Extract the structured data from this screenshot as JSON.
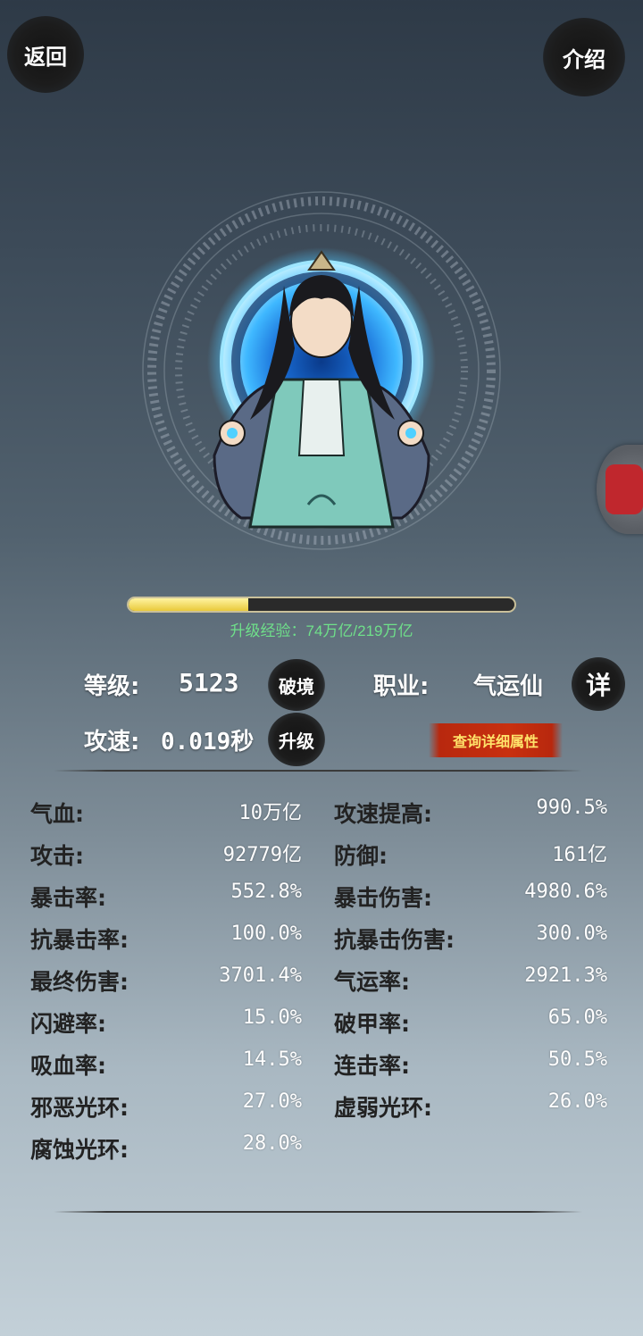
{
  "header": {
    "back_label": "返回",
    "intro_label": "介绍"
  },
  "xp": {
    "text": "升级经验：74万亿/219万亿",
    "progress": 0.31
  },
  "info": {
    "level_label": "等级:",
    "level_value": "5123",
    "breakthrough_label": "破境",
    "class_label": "职业:",
    "class_value": "气运仙",
    "detail_label": "详",
    "speed_label": "攻速:",
    "speed_value": "0.019秒",
    "upgrade_label": "升级",
    "query_label": "查询详细属性"
  },
  "stats": [
    {
      "left_label": "气血:",
      "left_value": "10万亿",
      "right_label": "攻速提高:",
      "right_value": "990.5%"
    },
    {
      "left_label": "攻击:",
      "left_value": "92779亿",
      "right_label": "防御:",
      "right_value": "161亿"
    },
    {
      "left_label": "暴击率:",
      "left_value": "552.8%",
      "right_label": "暴击伤害:",
      "right_value": "4980.6%"
    },
    {
      "left_label": "抗暴击率:",
      "left_value": "100.0%",
      "right_label": "抗暴击伤害:",
      "right_value": "300.0%"
    },
    {
      "left_label": "最终伤害:",
      "left_value": "3701.4%",
      "right_label": "气运率:",
      "right_value": "2921.3%"
    },
    {
      "left_label": "闪避率:",
      "left_value": "15.0%",
      "right_label": "破甲率:",
      "right_value": "65.0%"
    },
    {
      "left_label": "吸血率:",
      "left_value": "14.5%",
      "right_label": "连击率:",
      "right_value": "50.5%"
    },
    {
      "left_label": "邪恶光环:",
      "left_value": "27.0%",
      "right_label": "虚弱光环:",
      "right_value": "26.0%"
    },
    {
      "left_label": "腐蚀光环:",
      "left_value": "28.0%",
      "right_label": "",
      "right_value": ""
    }
  ]
}
